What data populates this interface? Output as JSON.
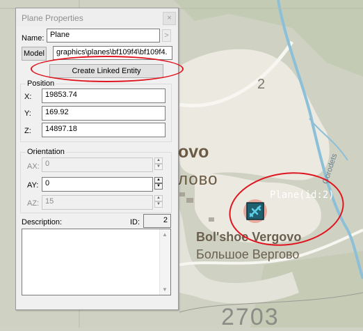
{
  "dialog": {
    "title": "Plane Properties",
    "close_glyph": "×",
    "name_label": "Name:",
    "name_value": "Plane",
    "name_arrow": ">",
    "model_button": "Model",
    "model_path": "graphics\\planes\\bf109f4\\bf109f4.",
    "create_linked_entity": "Create Linked Entity",
    "position": {
      "group_label": "Position",
      "x_label": "X:",
      "x_value": "19853.74",
      "y_label": "Y:",
      "y_value": "169.92",
      "z_label": "Z:",
      "z_value": "14897.18"
    },
    "orientation": {
      "group_label": "Orientation",
      "ax_label": "AX:",
      "ax_value": "0",
      "ay_label": "AY:",
      "ay_value": "0",
      "az_label": "AZ:",
      "az_value": "15"
    },
    "description_label": "Description:",
    "id_label": "ID:",
    "id_value": "2"
  },
  "map": {
    "entity_label": "Plane(id:2)",
    "labels": {
      "ovo": "ovo",
      "lovo": "лово",
      "region_number": "2",
      "village_latin": "Bol'shoe Vergovo",
      "village_cyrillic": "Большое Вергово",
      "river": "Gorodets",
      "elevation": "2703"
    },
    "colors": {
      "annotation": "#e0141e",
      "selection_glow": "#e8a090",
      "plane_icon_bg": "#1f5f6e",
      "plane_icon_fg": "#5fd0ea",
      "river": "#8cc0d8",
      "settlement": "#ebe9e0"
    }
  }
}
